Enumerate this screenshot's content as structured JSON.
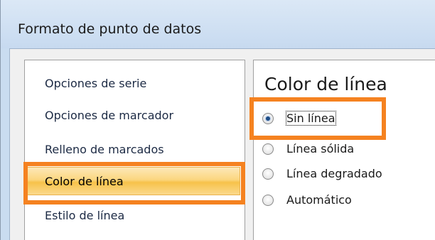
{
  "window": {
    "title": "Formato de punto de datos"
  },
  "nav": {
    "items": [
      {
        "label": "Opciones de serie"
      },
      {
        "label": "Opciones de marcador"
      },
      {
        "label": "Relleno de marcados"
      },
      {
        "label": "Color de línea"
      },
      {
        "label": "Estilo de línea"
      }
    ],
    "selected": "Color de línea"
  },
  "content": {
    "heading": "Color de línea",
    "options": [
      {
        "label": "Sin línea",
        "checked": true
      },
      {
        "label": "Línea sólida",
        "checked": false
      },
      {
        "label": "Línea degradado",
        "checked": false
      },
      {
        "label": "Automático",
        "checked": false
      }
    ]
  },
  "colors": {
    "highlight": "#f58220",
    "selection_gradient": "#f7c24a",
    "title_bar": "#c7daf0"
  }
}
